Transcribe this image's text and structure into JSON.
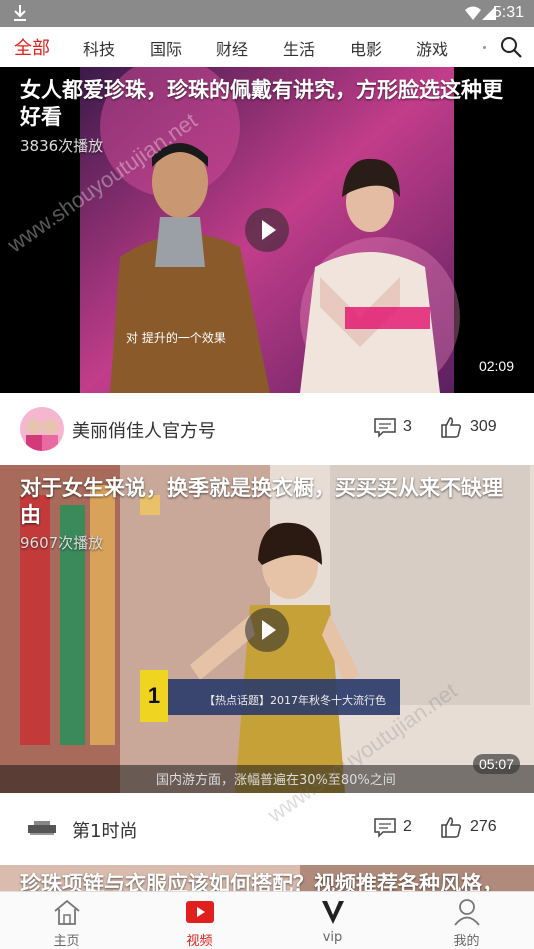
{
  "status_bar": {
    "time": "5:31",
    "icons": [
      "download-icon",
      "wifi-icon",
      "signal-icon"
    ]
  },
  "tabs": [
    {
      "label": "全部",
      "active": true
    },
    {
      "label": "科技",
      "active": false
    },
    {
      "label": "国际",
      "active": false
    },
    {
      "label": "财经",
      "active": false
    },
    {
      "label": "生活",
      "active": false
    },
    {
      "label": "电影",
      "active": false
    },
    {
      "label": "游戏",
      "active": false
    }
  ],
  "videos": [
    {
      "title": "女人都爱珍珠，珍珠的佩戴有讲究，方形脸选这种更好看",
      "plays": "3836次播放",
      "duration": "02:09",
      "subtitle": "对 提升的一个效果",
      "author": "美丽俏佳人官方号",
      "comments": "3",
      "likes": "309"
    },
    {
      "title": "对于女生来说，换季就是换衣橱，买买买从来不缺理由",
      "plays": "9607次播放",
      "duration": "05:07",
      "subtitle": "【热点话题】2017年秋冬十大流行色",
      "ticker": "国内游方面，涨幅普遍在30%至80%之间",
      "author": "第1时尚",
      "comments": "2",
      "likes": "276"
    },
    {
      "title": "珍珠项链与衣服应该如何搭配？视频推荐各种风格，"
    }
  ],
  "bottom_nav": [
    {
      "label": "主页",
      "icon": "home-icon",
      "active": false
    },
    {
      "label": "视频",
      "icon": "video-icon",
      "active": true
    },
    {
      "label": "vip",
      "icon": "vip-icon",
      "active": false
    },
    {
      "label": "我的",
      "icon": "profile-icon",
      "active": false
    }
  ],
  "watermark": "www.shouyoutujian.net",
  "colors": {
    "accent": "#e0201e",
    "status_bar": "#8a8a8a"
  }
}
